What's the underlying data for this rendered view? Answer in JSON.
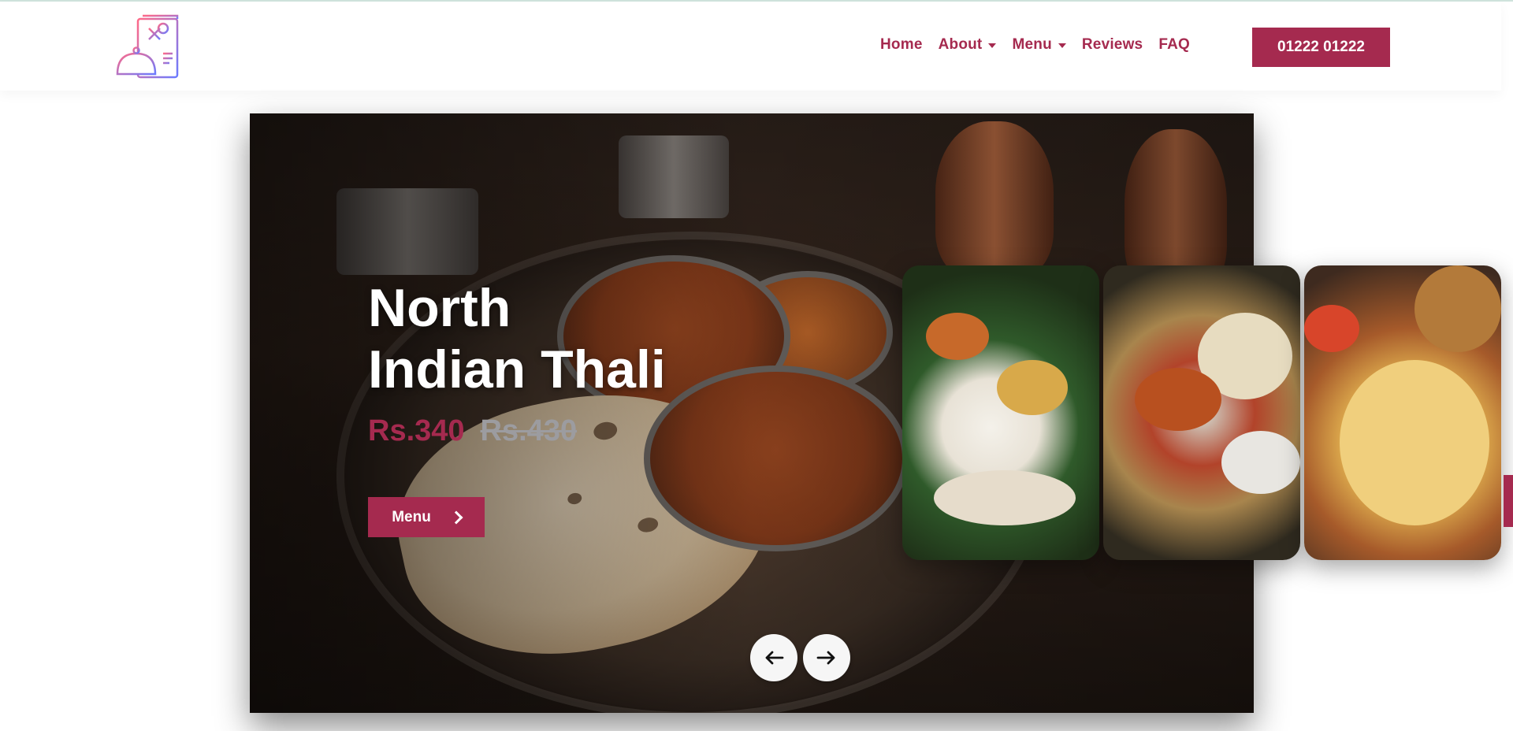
{
  "header": {
    "logo_alt": "restaurant-logo",
    "nav": [
      {
        "label": "Home",
        "has_dropdown": false
      },
      {
        "label": "About",
        "has_dropdown": true
      },
      {
        "label": "Menu",
        "has_dropdown": true
      },
      {
        "label": "Reviews",
        "has_dropdown": false
      },
      {
        "label": "FAQ",
        "has_dropdown": false
      }
    ],
    "phone_label": "01222 01222"
  },
  "hero": {
    "title_line1": "North",
    "title_line2": "Indian Thali",
    "price_new": "Rs.340",
    "price_old": "Rs.430",
    "button_label": "Menu",
    "prev_icon": "arrow-left-icon",
    "next_icon": "arrow-right-icon"
  },
  "thumbnails": [
    {
      "name": "thumb-rice-curry"
    },
    {
      "name": "thumb-thali-platter"
    },
    {
      "name": "thumb-puri"
    }
  ],
  "colors": {
    "accent": "#a52a4f",
    "old_price": "#9c9ca0",
    "white": "#ffffff"
  }
}
